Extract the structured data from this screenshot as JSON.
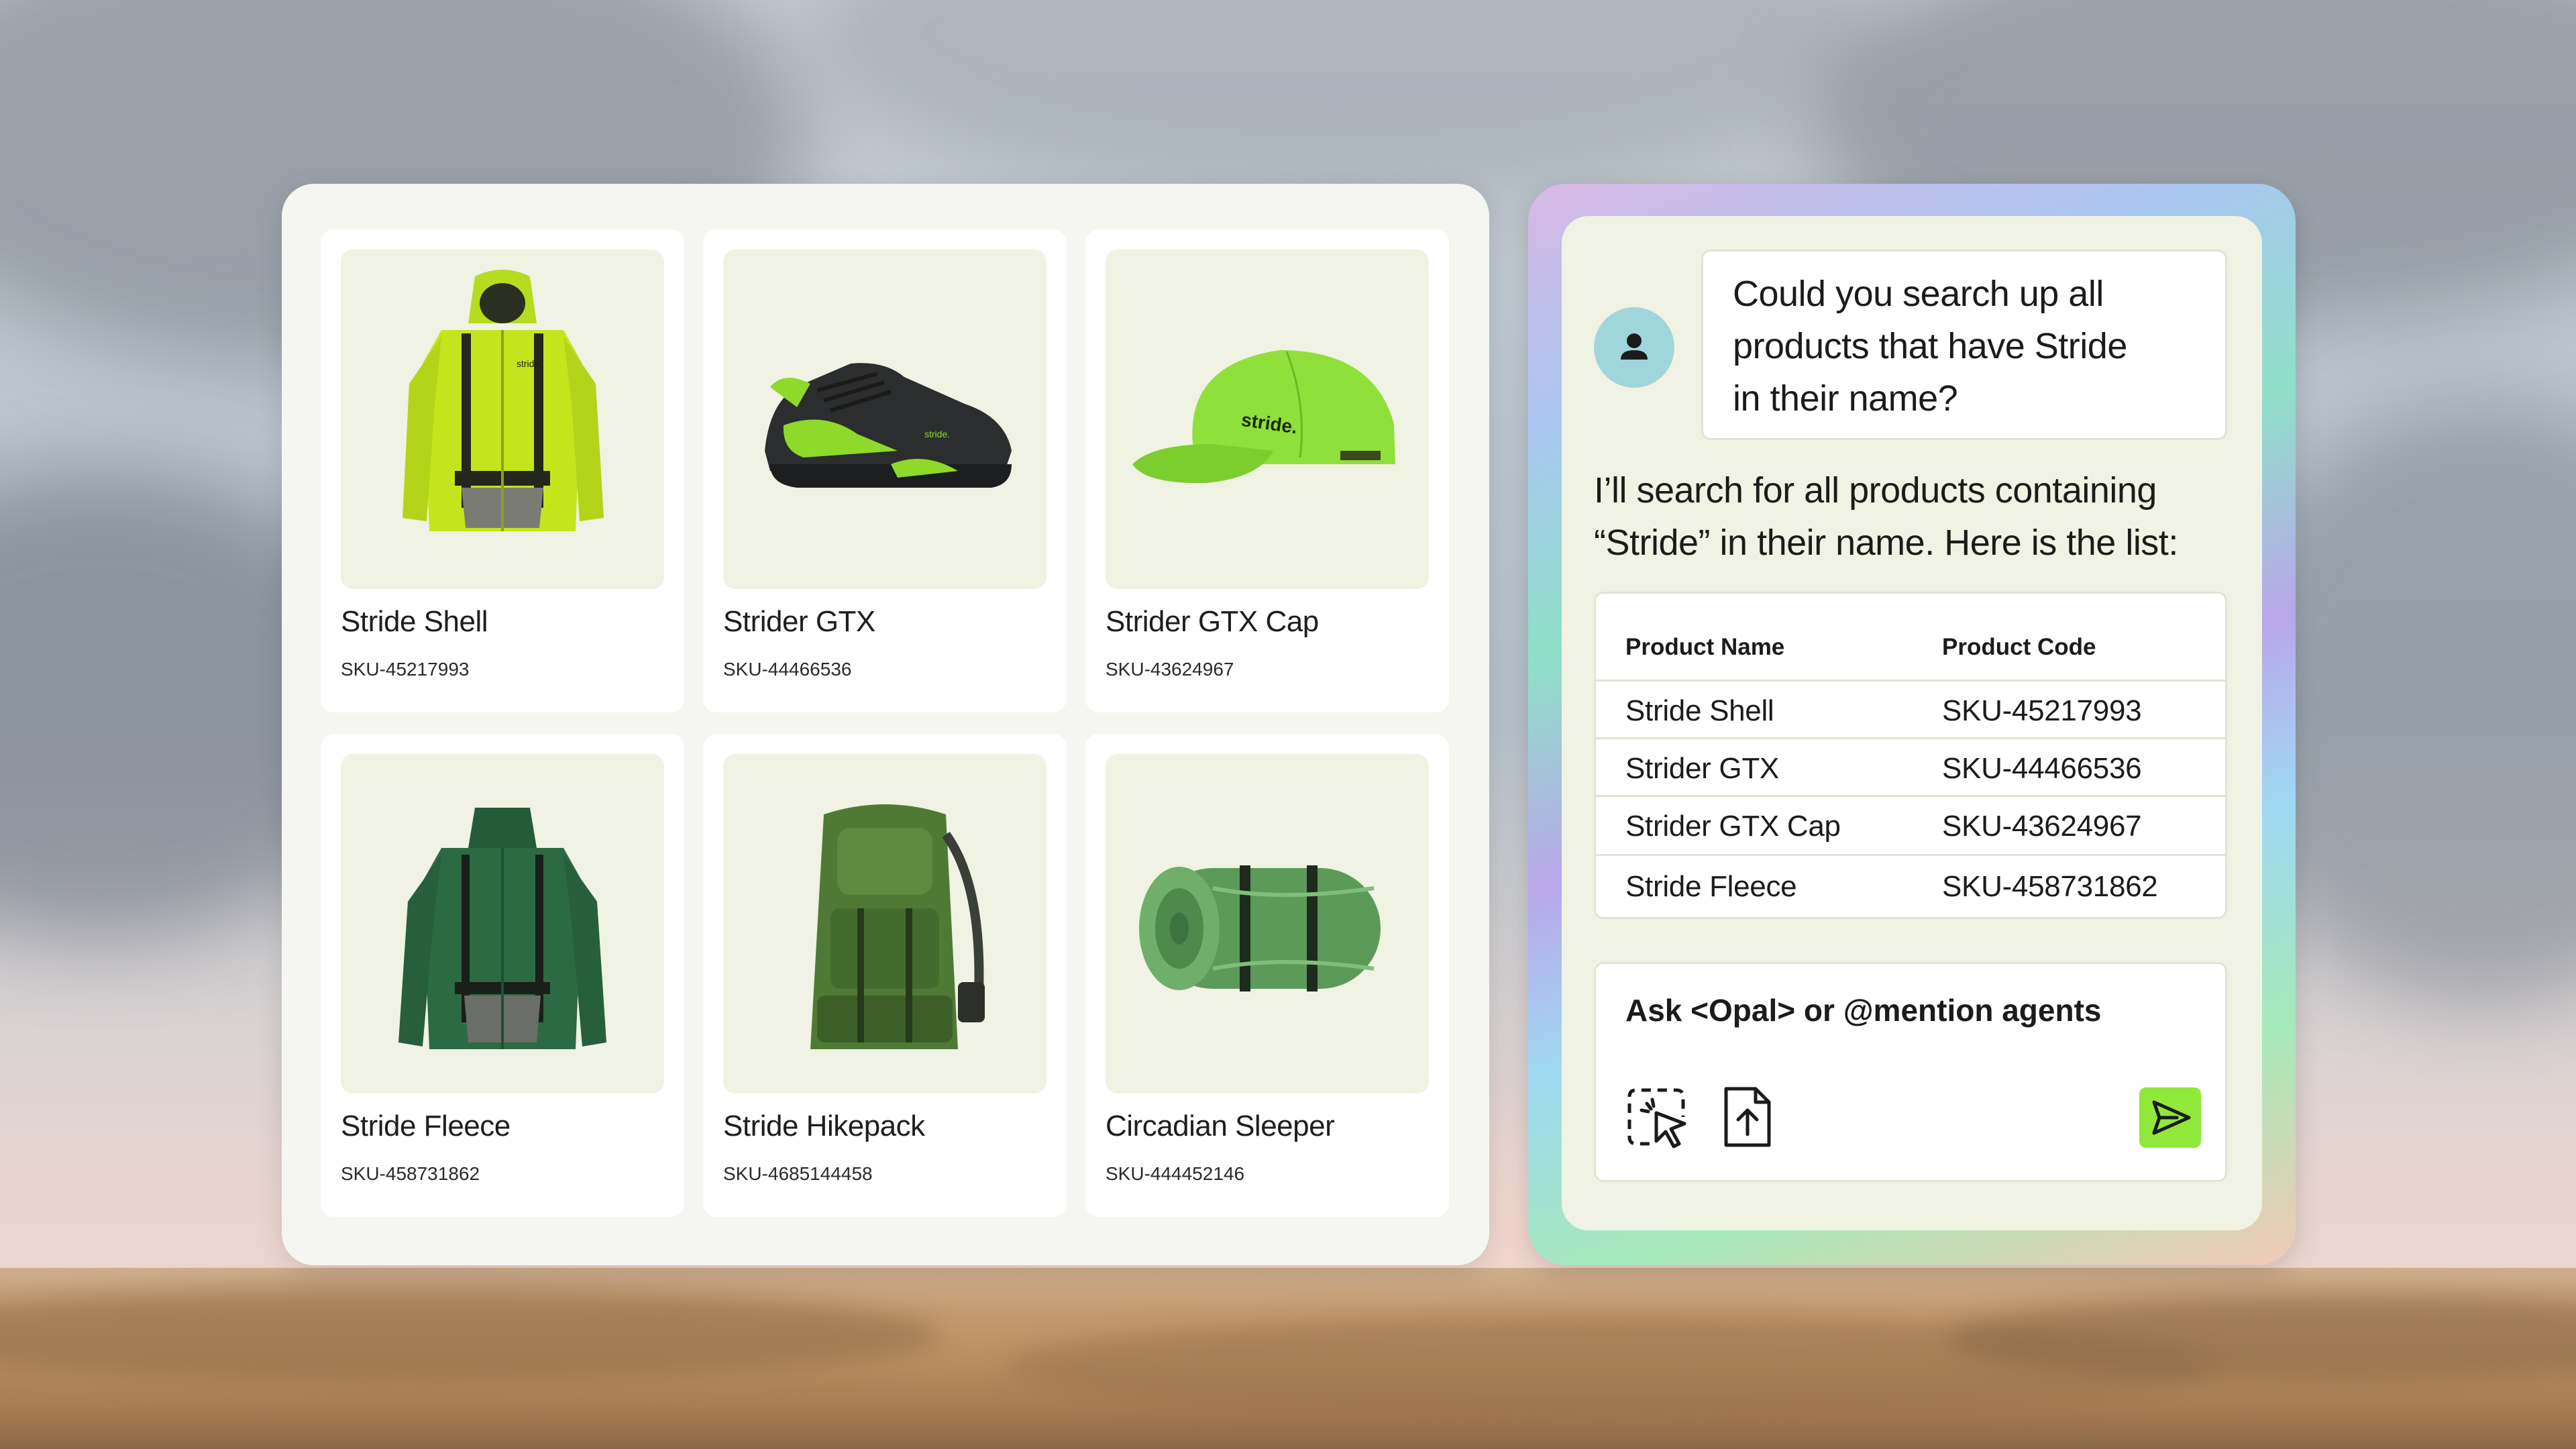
{
  "products": [
    {
      "name": "Stride Shell",
      "sku": "SKU-45217993",
      "image_icon": "green-rain-jacket-icon"
    },
    {
      "name": "Strider GTX",
      "sku": "SKU-44466536",
      "image_icon": "trail-shoe-icon"
    },
    {
      "name": "Strider GTX Cap",
      "sku": "SKU-43624967",
      "image_icon": "cap-icon"
    },
    {
      "name": "Stride Fleece",
      "sku": "SKU-458731862",
      "image_icon": "fleece-jacket-icon"
    },
    {
      "name": "Stride Hikepack",
      "sku": "SKU-4685144458",
      "image_icon": "backpack-icon"
    },
    {
      "name": "Circadian Sleeper",
      "sku": "SKU-444452146",
      "image_icon": "sleeping-bag-icon"
    }
  ],
  "brand_text": "stride.",
  "chat": {
    "user_message_lines": [
      "Could you search up all",
      "products that have Stride",
      "in their name?"
    ],
    "agent_message_lines": [
      "I’ll search for all products containing",
      "“Stride” in their name. Here is the list:"
    ],
    "table": {
      "headers": [
        "Product Name",
        "Product Code"
      ],
      "rows": [
        [
          "Stride Shell",
          "SKU-45217993"
        ],
        [
          "Strider GTX",
          "SKU-44466536"
        ],
        [
          "Strider GTX Cap",
          "SKU-43624967"
        ],
        [
          "Stride Fleece",
          "SKU-458731862"
        ]
      ]
    },
    "composer": {
      "placeholder": "Ask <Opal> or @mention agents",
      "tools": [
        "pointer-select-icon",
        "file-upload-icon"
      ],
      "send_icon": "send-icon"
    }
  },
  "colors": {
    "accent_green": "#8fe83a",
    "panel_bg": "#f5f6f1",
    "chat_bg": "#f0f2e3",
    "image_bg": "#f0f2e3",
    "avatar_bg": "#9fd6dc"
  }
}
